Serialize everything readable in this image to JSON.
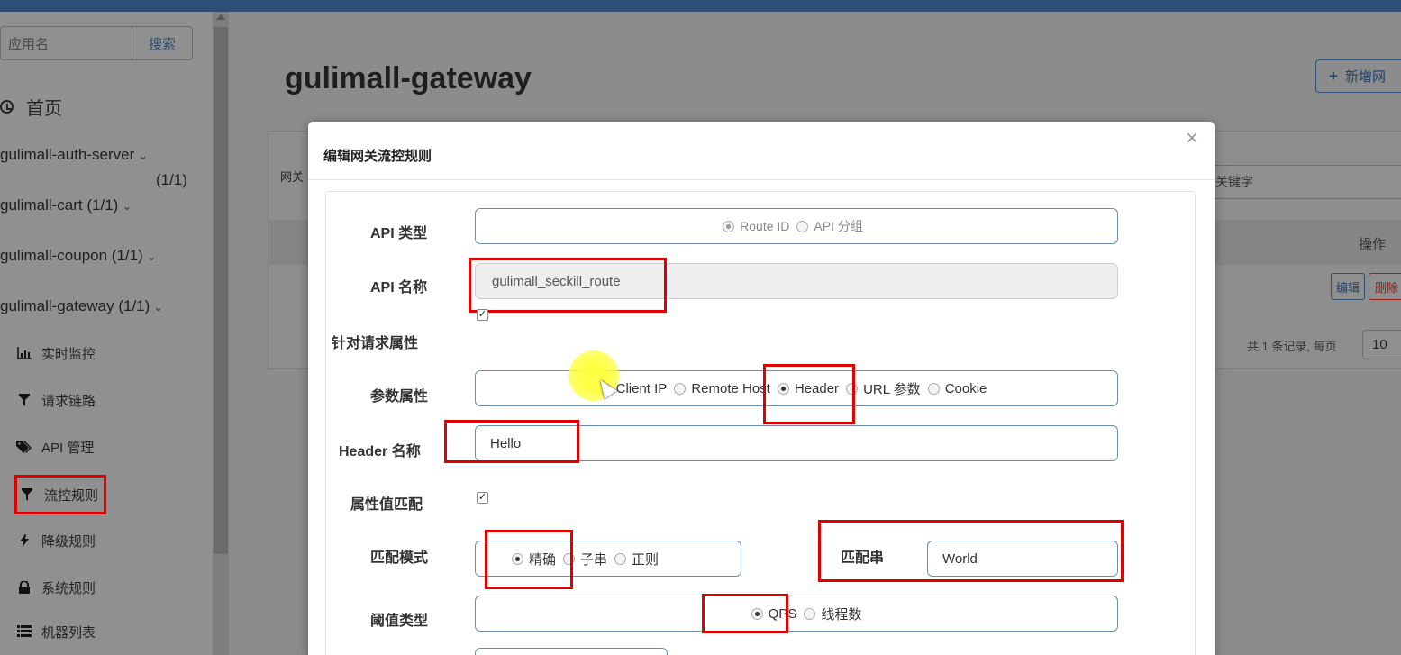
{
  "sidebar": {
    "search_placeholder": "应用名",
    "search_button": "搜索",
    "home": "首页",
    "apps": [
      {
        "name": "gulimall-auth-server",
        "count": "(1/1)"
      },
      {
        "name": "gulimall-cart (1/1)"
      },
      {
        "name": "gulimall-coupon  (1/1)"
      },
      {
        "name": "gulimall-gateway (1/1)"
      }
    ],
    "chevron": "⌄",
    "menu": [
      {
        "label": "实时监控",
        "icon": "bar-chart-icon"
      },
      {
        "label": "请求链路",
        "icon": "filter-icon"
      },
      {
        "label": "API 管理",
        "icon": "tag-icon"
      },
      {
        "label": "流控规则",
        "icon": "filter-icon"
      },
      {
        "label": "降级规则",
        "icon": "bolt-icon"
      },
      {
        "label": "系统规则",
        "icon": "lock-icon"
      },
      {
        "label": "机器列表",
        "icon": "list-icon"
      }
    ]
  },
  "main": {
    "title": "gulimall-gateway",
    "add_button": "新增网",
    "panel_label": "网关",
    "keyword_placeholder": "关键字",
    "op_header": "操作",
    "edit_button": "编辑",
    "delete_button": "删除",
    "pagination_text": "共 1 条记录, 每页",
    "page_size": "10"
  },
  "modal": {
    "title": "编辑网关流控规则",
    "close": "×",
    "api_type_label": "API 类型",
    "api_type_options": [
      "Route ID",
      "API 分组"
    ],
    "api_name_label": "API 名称",
    "api_name_value": "gulimall_seckill_route",
    "req_attr_label": "针对请求属性",
    "param_attr_label": "参数属性",
    "param_attr_options": [
      "Client IP",
      "Remote Host",
      "Header",
      "URL 参数",
      "Cookie"
    ],
    "header_name_label": "Header 名称",
    "header_name_value": "Hello",
    "attr_match_label": "属性值匹配",
    "match_mode_label": "匹配模式",
    "match_mode_options": [
      "精确",
      "子串",
      "正则"
    ],
    "match_string_label": "匹配串",
    "match_string_value": "World",
    "threshold_type_label": "阈值类型",
    "threshold_type_options": [
      "QPS",
      "线程数"
    ]
  },
  "colors": {
    "highlight": "#e00000",
    "topbar": "#2c4f75"
  }
}
